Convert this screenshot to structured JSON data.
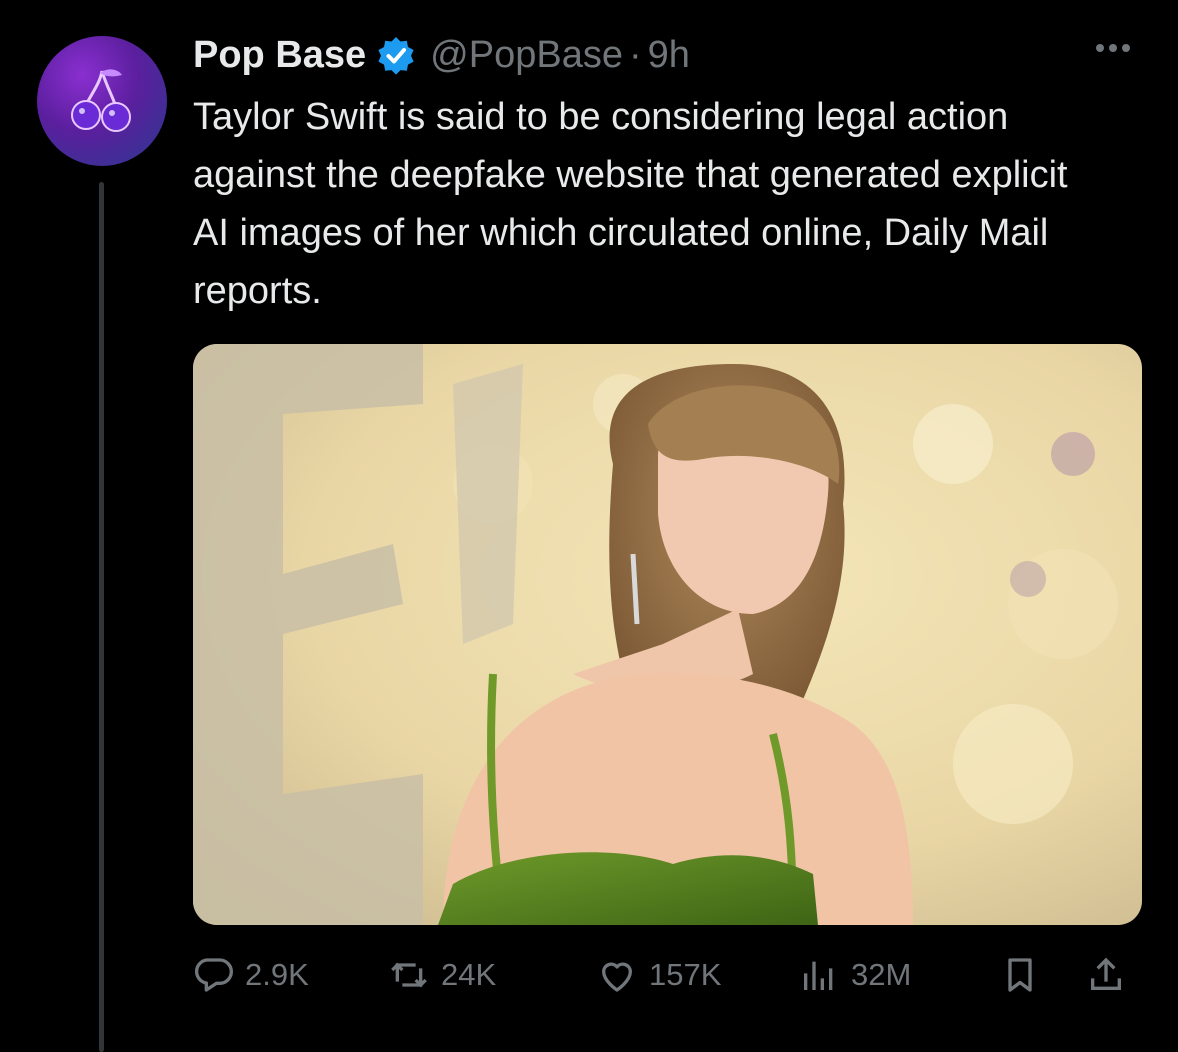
{
  "post": {
    "author_name": "Pop Base",
    "handle": "@PopBase",
    "separator": "·",
    "time": "9h",
    "text": "Taylor Swift is said to be considering legal action against the deepfake website that generated explicit AI images of her which circulated online, Daily Mail reports."
  },
  "actions": {
    "replies": "2.9K",
    "reposts": "24K",
    "likes": "157K",
    "views": "32M"
  },
  "icons": {
    "avatar": "cherry-icon",
    "verified": "verified-badge-icon",
    "more": "more-options-icon",
    "reply": "reply-icon",
    "repost": "repost-icon",
    "like": "heart-icon",
    "views": "views-chart-icon",
    "bookmark": "bookmark-icon",
    "share": "share-icon"
  },
  "colors": {
    "background": "#000000",
    "text": "#e7e9ea",
    "muted": "#71767b",
    "verified": "#1d9bf0"
  }
}
